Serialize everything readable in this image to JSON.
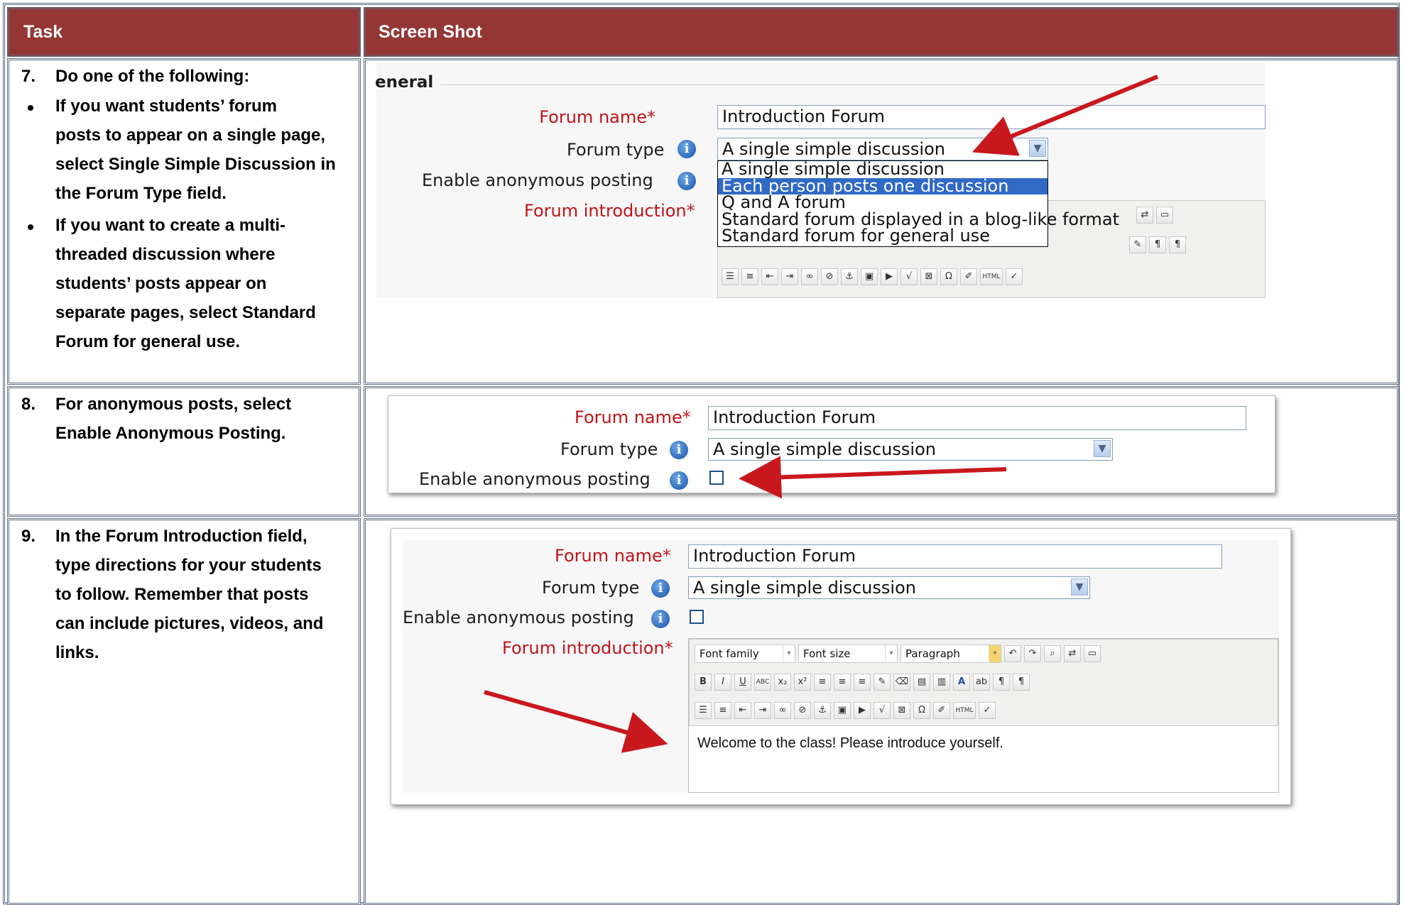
{
  "header": {
    "task": "Task",
    "screenshot": "Screen Shot"
  },
  "rows": [
    {
      "number": "7.",
      "lines": [
        "Do one of the following:"
      ],
      "bullets": [
        [
          "If you want students’ forum",
          "posts to appear on a single page,",
          "select Single Simple Discussion in",
          "the Forum Type field."
        ],
        [
          "If you want to create a multi-",
          "threaded discussion where",
          "students’ posts appear on",
          "separate pages, select Standard",
          "Forum for general use."
        ]
      ]
    },
    {
      "number": "8.",
      "lines": [
        "For anonymous posts, select",
        "Enable Anonymous Posting."
      ]
    },
    {
      "number": "9.",
      "lines": [
        "In the Forum Introduction field,",
        "type directions for your students",
        "to follow. Remember that posts",
        "can include pictures, videos, and",
        "links."
      ]
    }
  ],
  "shot1": {
    "section": "eneral",
    "forum_name_label": "Forum name",
    "forum_name_value": "Introduction Forum",
    "forum_type_label": "Forum type",
    "forum_type_value": "A single simple discussion",
    "anon_label": "Enable anonymous posting",
    "intro_label": "Forum introduction",
    "options": [
      "A single simple discussion",
      "Each person posts one discussion",
      "Q and A forum",
      "Standard forum displayed in a blog-like format",
      "Standard forum for general use"
    ],
    "selected_option_index": 1
  },
  "shot2": {
    "forum_name_label": "Forum name",
    "forum_name_value": "Introduction Forum",
    "forum_type_label": "Forum type",
    "forum_type_value": "A single simple discussion",
    "anon_label": "Enable anonymous posting"
  },
  "shot3": {
    "forum_name_label": "Forum name",
    "forum_name_value": "Introduction Forum",
    "forum_type_label": "Forum type",
    "forum_type_value": "A single simple discussion",
    "anon_label": "Enable anonymous posting",
    "intro_label": "Forum introduction",
    "font_family": "Font family",
    "font_size": "Font size",
    "paragraph": "Paragraph",
    "editor_text": "Welcome to the class! Please introduce yourself."
  },
  "colors": {
    "header_bg": "#943634",
    "required_label": "#c0141a",
    "selected_option": "#316ac5",
    "arrow": "#c8181e"
  }
}
